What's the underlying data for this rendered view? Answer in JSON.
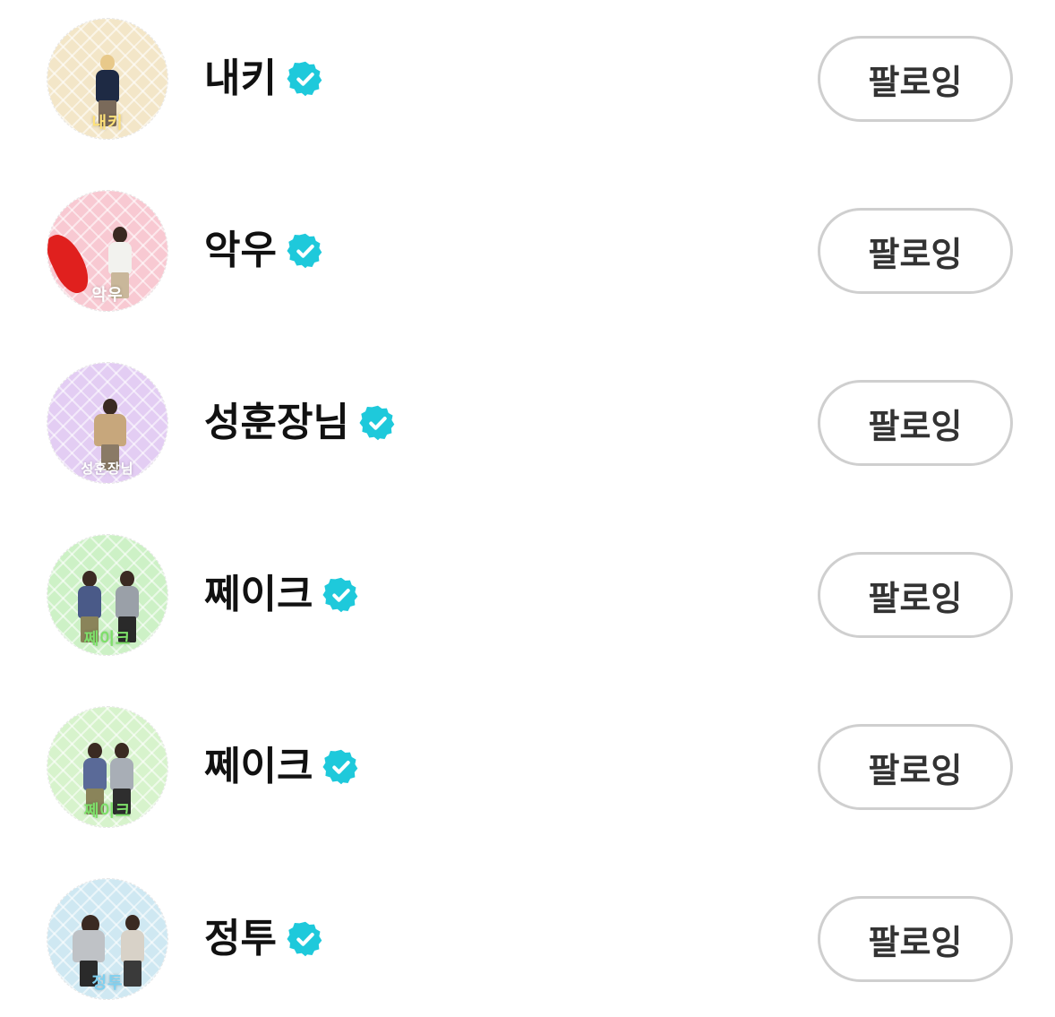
{
  "colors": {
    "verified_badge": "#1ec9db",
    "button_border": "#cfcfcf",
    "name_text": "#111111"
  },
  "icons": {
    "verified": "verified-badge-icon"
  },
  "following": [
    {
      "name": "내키",
      "avatar_label": "내키",
      "verified": true,
      "button_label": "팔로잉",
      "theme": "#f3e6c8"
    },
    {
      "name": "악우",
      "avatar_label": "악우",
      "verified": true,
      "button_label": "팔로잉",
      "theme": "#f8c9d2"
    },
    {
      "name": "성훈장님",
      "avatar_label": "성훈장님",
      "verified": true,
      "button_label": "팔로잉",
      "theme": "#e3cdf3"
    },
    {
      "name": "쩨이크",
      "avatar_label": "쩨이크",
      "verified": true,
      "button_label": "팔로잉",
      "theme": "#cdf1c6"
    },
    {
      "name": "쩨이크",
      "avatar_label": "쩨이크",
      "verified": true,
      "button_label": "팔로잉",
      "theme": "#d7f3cc"
    },
    {
      "name": "정투",
      "avatar_label": "정투",
      "verified": true,
      "button_label": "팔로잉",
      "theme": "#cfe8f2"
    }
  ]
}
